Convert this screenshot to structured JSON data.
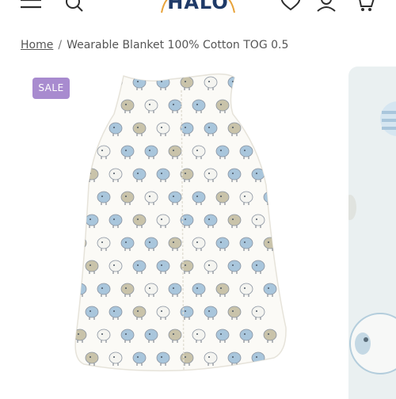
{
  "header": {
    "logo_text": "HALO",
    "icons": [
      "menu-icon",
      "search-icon",
      "heart-icon",
      "user-icon",
      "cart-icon"
    ]
  },
  "breadcrumb": {
    "home_label": "Home",
    "separator": "/",
    "current": "Wearable Blanket 100% Cotton TOG 0.5"
  },
  "product": {
    "badge": "SALE",
    "colors": {
      "badge_bg": "#a88bcf",
      "sheep_blue": "#a9c6dc",
      "sheep_tan": "#c9c3aa",
      "sheep_white": "#f4f4f0",
      "fabric": "#fbfaf6"
    }
  }
}
